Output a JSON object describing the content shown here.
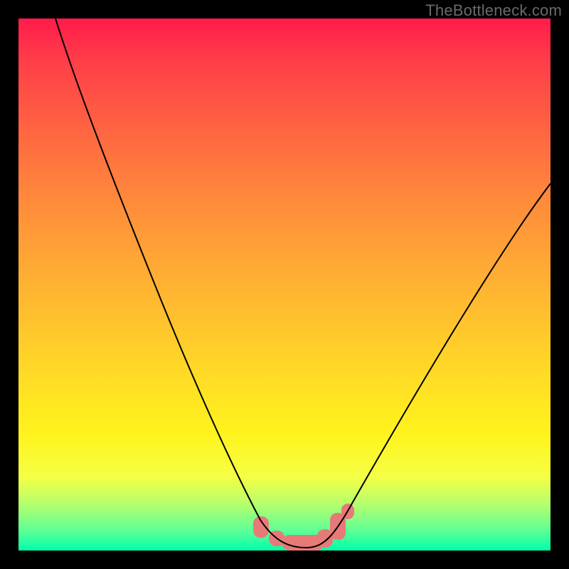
{
  "watermark": "TheBottleneck.com",
  "colors": {
    "frame": "#000000",
    "gradient_top": "#ff1c4a",
    "gradient_bottom": "#00ffab",
    "curve": "#000000",
    "marker": "#e77a78",
    "watermark_text": "#6a6a6a"
  },
  "chart_data": {
    "type": "line",
    "title": "",
    "xlabel": "",
    "ylabel": "",
    "xlim": [
      0,
      100
    ],
    "ylim": [
      0,
      100
    ],
    "x": [
      7,
      10,
      15,
      20,
      25,
      30,
      35,
      40,
      45,
      48,
      50,
      52,
      55,
      58,
      60,
      65,
      70,
      75,
      80,
      85,
      90,
      95,
      100
    ],
    "y": [
      100,
      90,
      78,
      66,
      55,
      43,
      32,
      20,
      9,
      4,
      2,
      1,
      0.5,
      0.8,
      2,
      8,
      17,
      27,
      37,
      47,
      57,
      66,
      73
    ],
    "marker_region_x": [
      45,
      60
    ],
    "annotations": []
  }
}
